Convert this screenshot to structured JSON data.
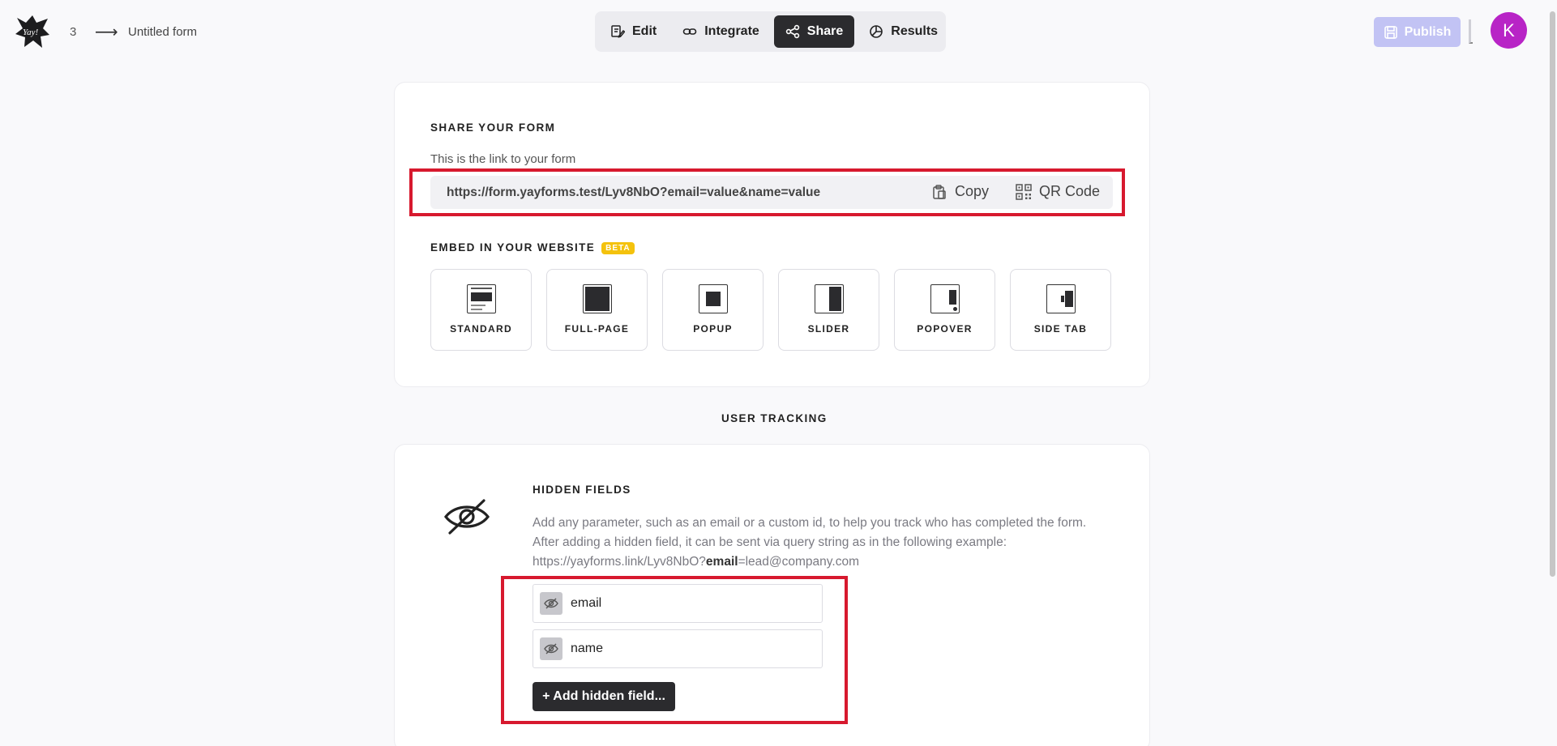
{
  "header": {
    "logo_text": "Yay!",
    "breadcrumb_number": "3",
    "breadcrumb_arrow": "⟶",
    "form_title": "Untitled form",
    "tabs": [
      {
        "label": "Edit",
        "icon": "edit-icon",
        "active": false
      },
      {
        "label": "Integrate",
        "icon": "link-icon",
        "active": false
      },
      {
        "label": "Share",
        "icon": "share-icon",
        "active": true
      },
      {
        "label": "Results",
        "icon": "pie-chart-icon",
        "active": false
      }
    ],
    "publish_label": "Publish",
    "avatar_initial": "K"
  },
  "share": {
    "title": "SHARE YOUR FORM",
    "link_caption": "This is the link to your form",
    "url": "https://form.yayforms.test/Lyv8NbO?email=value&name=value",
    "copy_label": "Copy",
    "qr_label": "QR Code"
  },
  "embed": {
    "title": "EMBED IN YOUR WEBSITE",
    "beta_badge": "BETA",
    "options": [
      "STANDARD",
      "FULL-PAGE",
      "POPUP",
      "SLIDER",
      "POPOVER",
      "SIDE TAB"
    ]
  },
  "tracking": {
    "section_title": "USER TRACKING",
    "hidden_fields_title": "HIDDEN FIELDS",
    "desc_line1": "Add any parameter, such as an email or a custom id, to help you track who has completed the form.",
    "desc_line2": "After adding a hidden field, it can be sent via query string as in the following example:",
    "example_prefix": "https://yayforms.link/Lyv8NbO?",
    "example_key": "email",
    "example_suffix": "=lead@company.com",
    "fields": [
      "email",
      "name"
    ],
    "add_button": "+ Add hidden field..."
  },
  "colors": {
    "accent_dark": "#2b2b2e",
    "publish_disabled": "#c2c3f4",
    "avatar": "#b824c6",
    "beta": "#f4c20d",
    "highlight": "#d7192e"
  }
}
